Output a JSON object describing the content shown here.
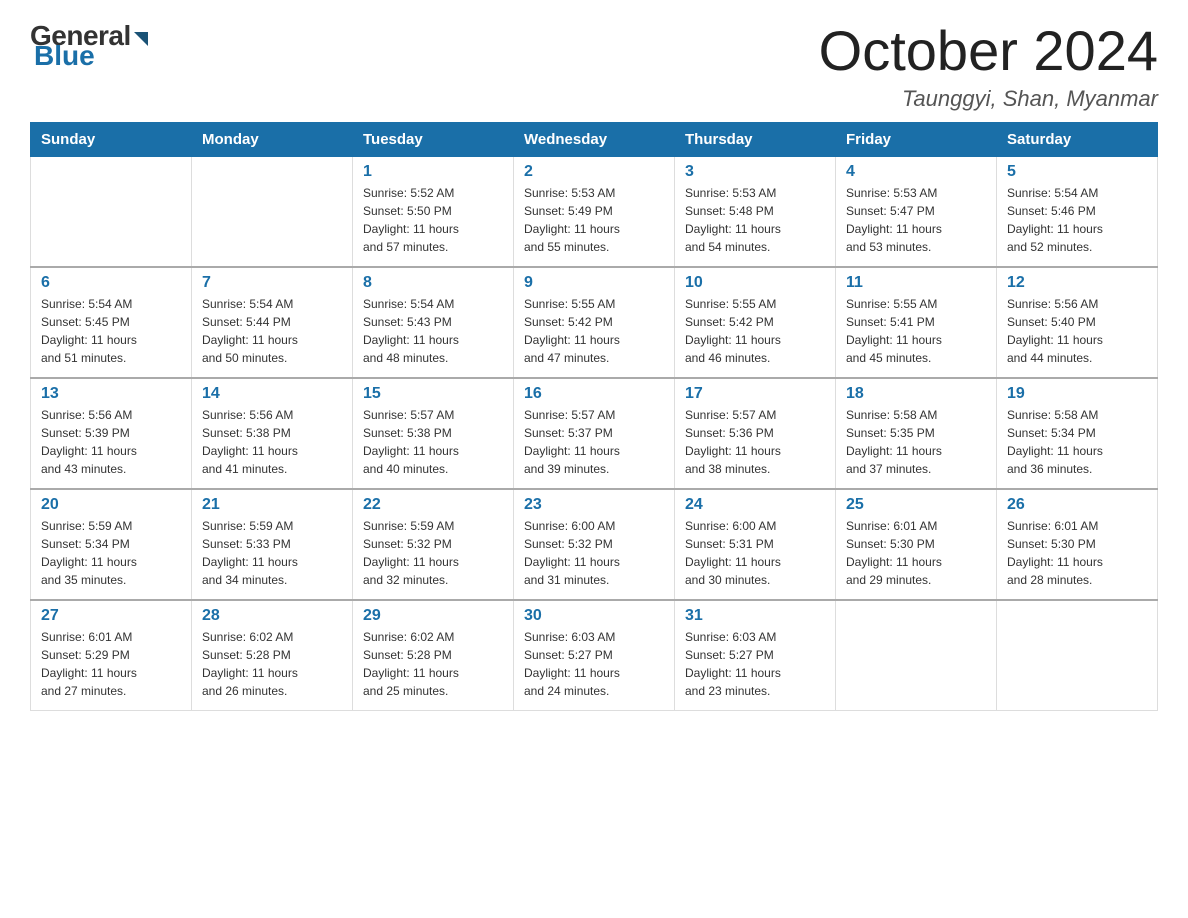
{
  "header": {
    "logo_general": "General",
    "logo_blue": "Blue",
    "month_title": "October 2024",
    "location": "Taunggyi, Shan, Myanmar"
  },
  "days_of_week": [
    "Sunday",
    "Monday",
    "Tuesday",
    "Wednesday",
    "Thursday",
    "Friday",
    "Saturday"
  ],
  "weeks": [
    [
      {
        "day": "",
        "info": ""
      },
      {
        "day": "",
        "info": ""
      },
      {
        "day": "1",
        "info": "Sunrise: 5:52 AM\nSunset: 5:50 PM\nDaylight: 11 hours\nand 57 minutes."
      },
      {
        "day": "2",
        "info": "Sunrise: 5:53 AM\nSunset: 5:49 PM\nDaylight: 11 hours\nand 55 minutes."
      },
      {
        "day": "3",
        "info": "Sunrise: 5:53 AM\nSunset: 5:48 PM\nDaylight: 11 hours\nand 54 minutes."
      },
      {
        "day": "4",
        "info": "Sunrise: 5:53 AM\nSunset: 5:47 PM\nDaylight: 11 hours\nand 53 minutes."
      },
      {
        "day": "5",
        "info": "Sunrise: 5:54 AM\nSunset: 5:46 PM\nDaylight: 11 hours\nand 52 minutes."
      }
    ],
    [
      {
        "day": "6",
        "info": "Sunrise: 5:54 AM\nSunset: 5:45 PM\nDaylight: 11 hours\nand 51 minutes."
      },
      {
        "day": "7",
        "info": "Sunrise: 5:54 AM\nSunset: 5:44 PM\nDaylight: 11 hours\nand 50 minutes."
      },
      {
        "day": "8",
        "info": "Sunrise: 5:54 AM\nSunset: 5:43 PM\nDaylight: 11 hours\nand 48 minutes."
      },
      {
        "day": "9",
        "info": "Sunrise: 5:55 AM\nSunset: 5:42 PM\nDaylight: 11 hours\nand 47 minutes."
      },
      {
        "day": "10",
        "info": "Sunrise: 5:55 AM\nSunset: 5:42 PM\nDaylight: 11 hours\nand 46 minutes."
      },
      {
        "day": "11",
        "info": "Sunrise: 5:55 AM\nSunset: 5:41 PM\nDaylight: 11 hours\nand 45 minutes."
      },
      {
        "day": "12",
        "info": "Sunrise: 5:56 AM\nSunset: 5:40 PM\nDaylight: 11 hours\nand 44 minutes."
      }
    ],
    [
      {
        "day": "13",
        "info": "Sunrise: 5:56 AM\nSunset: 5:39 PM\nDaylight: 11 hours\nand 43 minutes."
      },
      {
        "day": "14",
        "info": "Sunrise: 5:56 AM\nSunset: 5:38 PM\nDaylight: 11 hours\nand 41 minutes."
      },
      {
        "day": "15",
        "info": "Sunrise: 5:57 AM\nSunset: 5:38 PM\nDaylight: 11 hours\nand 40 minutes."
      },
      {
        "day": "16",
        "info": "Sunrise: 5:57 AM\nSunset: 5:37 PM\nDaylight: 11 hours\nand 39 minutes."
      },
      {
        "day": "17",
        "info": "Sunrise: 5:57 AM\nSunset: 5:36 PM\nDaylight: 11 hours\nand 38 minutes."
      },
      {
        "day": "18",
        "info": "Sunrise: 5:58 AM\nSunset: 5:35 PM\nDaylight: 11 hours\nand 37 minutes."
      },
      {
        "day": "19",
        "info": "Sunrise: 5:58 AM\nSunset: 5:34 PM\nDaylight: 11 hours\nand 36 minutes."
      }
    ],
    [
      {
        "day": "20",
        "info": "Sunrise: 5:59 AM\nSunset: 5:34 PM\nDaylight: 11 hours\nand 35 minutes."
      },
      {
        "day": "21",
        "info": "Sunrise: 5:59 AM\nSunset: 5:33 PM\nDaylight: 11 hours\nand 34 minutes."
      },
      {
        "day": "22",
        "info": "Sunrise: 5:59 AM\nSunset: 5:32 PM\nDaylight: 11 hours\nand 32 minutes."
      },
      {
        "day": "23",
        "info": "Sunrise: 6:00 AM\nSunset: 5:32 PM\nDaylight: 11 hours\nand 31 minutes."
      },
      {
        "day": "24",
        "info": "Sunrise: 6:00 AM\nSunset: 5:31 PM\nDaylight: 11 hours\nand 30 minutes."
      },
      {
        "day": "25",
        "info": "Sunrise: 6:01 AM\nSunset: 5:30 PM\nDaylight: 11 hours\nand 29 minutes."
      },
      {
        "day": "26",
        "info": "Sunrise: 6:01 AM\nSunset: 5:30 PM\nDaylight: 11 hours\nand 28 minutes."
      }
    ],
    [
      {
        "day": "27",
        "info": "Sunrise: 6:01 AM\nSunset: 5:29 PM\nDaylight: 11 hours\nand 27 minutes."
      },
      {
        "day": "28",
        "info": "Sunrise: 6:02 AM\nSunset: 5:28 PM\nDaylight: 11 hours\nand 26 minutes."
      },
      {
        "day": "29",
        "info": "Sunrise: 6:02 AM\nSunset: 5:28 PM\nDaylight: 11 hours\nand 25 minutes."
      },
      {
        "day": "30",
        "info": "Sunrise: 6:03 AM\nSunset: 5:27 PM\nDaylight: 11 hours\nand 24 minutes."
      },
      {
        "day": "31",
        "info": "Sunrise: 6:03 AM\nSunset: 5:27 PM\nDaylight: 11 hours\nand 23 minutes."
      },
      {
        "day": "",
        "info": ""
      },
      {
        "day": "",
        "info": ""
      }
    ]
  ]
}
